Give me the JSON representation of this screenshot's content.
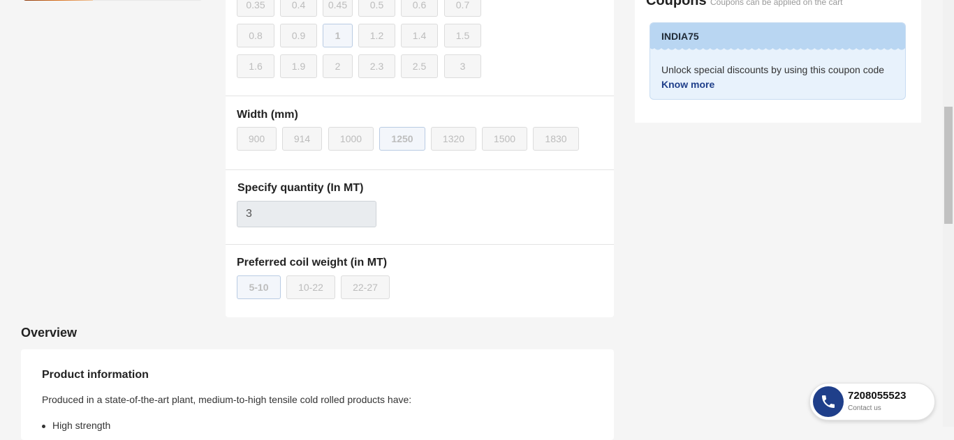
{
  "thickness": {
    "rows": [
      [
        {
          "label": "0.35"
        },
        {
          "label": "0.4"
        },
        {
          "label": "0.45"
        },
        {
          "label": "0.5"
        },
        {
          "label": "0.6"
        },
        {
          "label": "0.7"
        }
      ],
      [
        {
          "label": "0.8"
        },
        {
          "label": "0.9"
        },
        {
          "label": "1",
          "selected": true
        },
        {
          "label": "1.2"
        },
        {
          "label": "1.4"
        },
        {
          "label": "1.5"
        }
      ],
      [
        {
          "label": "1.6"
        },
        {
          "label": "1.9"
        },
        {
          "label": "2"
        },
        {
          "label": "2.3"
        },
        {
          "label": "2.5"
        },
        {
          "label": "3"
        }
      ]
    ]
  },
  "width": {
    "title": "Width (mm)",
    "options": [
      {
        "label": "900"
      },
      {
        "label": "914"
      },
      {
        "label": "1000"
      },
      {
        "label": "1250",
        "selected": true
      },
      {
        "label": "1320"
      },
      {
        "label": "1500"
      },
      {
        "label": "1830"
      }
    ]
  },
  "quantity": {
    "title": "Specify quantity (In MT)",
    "value": "3"
  },
  "coil_weight": {
    "title": "Preferred coil weight (in MT)",
    "options": [
      {
        "label": "5-10",
        "selected": true
      },
      {
        "label": "10-22"
      },
      {
        "label": "22-27"
      }
    ]
  },
  "overview": {
    "title": "Overview",
    "info_title": "Product information",
    "info_text": "Produced in a state-of-the-art plant, medium-to-high tensile cold rolled products have:",
    "bullet": "High strength"
  },
  "coupons": {
    "heading": "Coupons",
    "subheading": "Coupons can be applied on the cart",
    "code": "INDIA75",
    "description": "Unlock special discounts by using this coupon code",
    "link": "Know more"
  },
  "contact": {
    "number": "7208055523",
    "label": "Contact us"
  },
  "colors": {
    "accent": "#1f3f8a",
    "coupon_head": "#b9d6f2",
    "coupon_body": "#e8f2fc"
  }
}
